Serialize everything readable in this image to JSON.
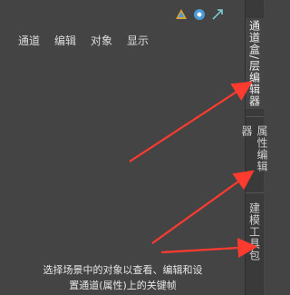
{
  "menubar": {
    "items": [
      "通道",
      "编辑",
      "对象",
      "显示"
    ]
  },
  "hint": {
    "line1": "选择场景中的对象以查看、编辑和设",
    "line2": "置通道(属性)上的关键帧"
  },
  "tabs": {
    "channel_box": "通道盒/层编辑器",
    "attribute_editor": "属性编辑器",
    "modeling_toolkit": "建模工具包"
  },
  "icons": {
    "icon1": "modeling-icon",
    "icon2": "settings-circle-icon",
    "icon3": "float-window-icon"
  },
  "annotation_color": "#ff3b30"
}
